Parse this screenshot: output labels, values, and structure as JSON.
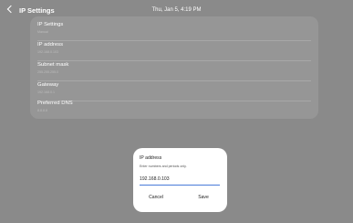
{
  "header": {
    "title": "IP Settings",
    "datetime": "Thu, Jan 5, 4:19 PM"
  },
  "settings": {
    "items": [
      {
        "label": "IP Settings",
        "value": "Manual"
      },
      {
        "label": "IP address",
        "value": "192.168.0.103"
      },
      {
        "label": "Subnet mask",
        "value": "255.255.255.0"
      },
      {
        "label": "Gateway",
        "value": "192.168.0.1"
      },
      {
        "label": "Preferred DNS",
        "value": "8.8.8.8"
      }
    ]
  },
  "dialog": {
    "title": "IP address",
    "subtitle": "Enter numbers and periods only.",
    "input_value": "192.168.0.103",
    "cancel_label": "Cancel",
    "save_label": "Save"
  },
  "colors": {
    "accent": "#4a7bd8",
    "background": "#8a8a8a"
  }
}
